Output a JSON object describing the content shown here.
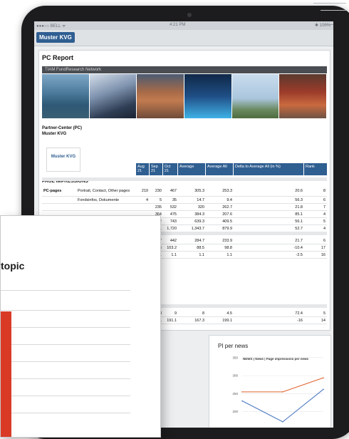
{
  "status_bar": {
    "carrier": "●●●○○ BELL ᯤ",
    "time": "4:21 PM",
    "battery": "✱ 100%"
  },
  "header": {
    "chip": "Muster KVG"
  },
  "report": {
    "title": "PC Report",
    "network": "TIAM FundResearch Network",
    "partner_center": "Partner-Center (PC)",
    "partner_name": "Muster KVG",
    "logo_text": "Muster KVG",
    "columns": [
      "Aug 21",
      "Sep 21",
      "Oct 21",
      "Average",
      "Average All",
      "Delta to Average All (in %)",
      "Rank"
    ],
    "section_page_impressions": "PAGE IMPRESSIONS",
    "pc_rows": [
      {
        "group": "PC-pages",
        "label": "Portrait, Contact, Other pages",
        "aug": "219",
        "sep": "230",
        "oct": "467",
        "avg": "305.3",
        "avg_all": "253.3",
        "delta": "20.6",
        "rank": "8"
      },
      {
        "group": "",
        "label": "Fondsinfos, Dokumente",
        "aug": "4",
        "sep": "5",
        "oct": "35",
        "avg": "14.7",
        "avg_all": "9.4",
        "delta": "56.3",
        "rank": "6"
      },
      {
        "group": "",
        "label": "",
        "aug": "",
        "sep": "235",
        "oct": "532",
        "avg": "320",
        "avg_all": "262.7",
        "delta": "21.8",
        "rank": "7"
      },
      {
        "group": "",
        "label": "",
        "aug": "",
        "sep": "364",
        "oct": "475",
        "avg": "384.3",
        "avg_all": "207.6",
        "delta": "85.1",
        "rank": "4"
      },
      {
        "group": "",
        "label": "",
        "aug": "",
        "sep": "482",
        "oct": "743",
        "avg": "639.3",
        "avg_all": "409.5",
        "delta": "56.1",
        "rank": "5"
      },
      {
        "group": "",
        "label": "",
        "aug": "",
        "sep": "1,081",
        "oct": "1,720",
        "avg": "1,343.7",
        "avg_all": "879.9",
        "delta": "52.7",
        "rank": "4"
      }
    ],
    "rows_b": [
      {
        "sep": "217",
        "oct": "442",
        "avg": "284.7",
        "avg_all": "233.9",
        "delta": "21.7",
        "rank": "6"
      },
      {
        "sep": "66.6",
        "oct": "103.2",
        "avg": "88.5",
        "avg_all": "98.8",
        "delta": "-10.4",
        "rank": "17"
      },
      {
        "sep": "1.1",
        "oct": "1.1",
        "avg": "1.1",
        "avg_all": "1.1",
        "delta": "-2.5",
        "rank": "16"
      }
    ],
    "rows_c": [
      {
        "aug": "8",
        "sep": "9",
        "oct": "8",
        "avg_all": "4.5",
        "delta": "72.4",
        "rank": "5"
      },
      {
        "aug": "135.1",
        "sep": "191.1",
        "oct": "167.3",
        "avg_all": "199.1",
        "delta": "-16",
        "rank": "14"
      }
    ]
  },
  "news_chart": {
    "card_title": "PI per news",
    "chart_data": {
      "type": "line",
      "title": "NEWS | News | Page impressions per news",
      "y_ticks": [
        "200",
        "250",
        "300",
        "350"
      ],
      "ylim": [
        150,
        320
      ],
      "x_count": 3,
      "series": [
        {
          "values": [
            255,
            255,
            294
          ],
          "color": "#e0622f"
        },
        {
          "values": [
            230,
            172,
            262
          ],
          "color": "#4a78c2"
        }
      ]
    }
  },
  "modal": {
    "topic": "topic",
    "accent_color": "#d93a26"
  }
}
